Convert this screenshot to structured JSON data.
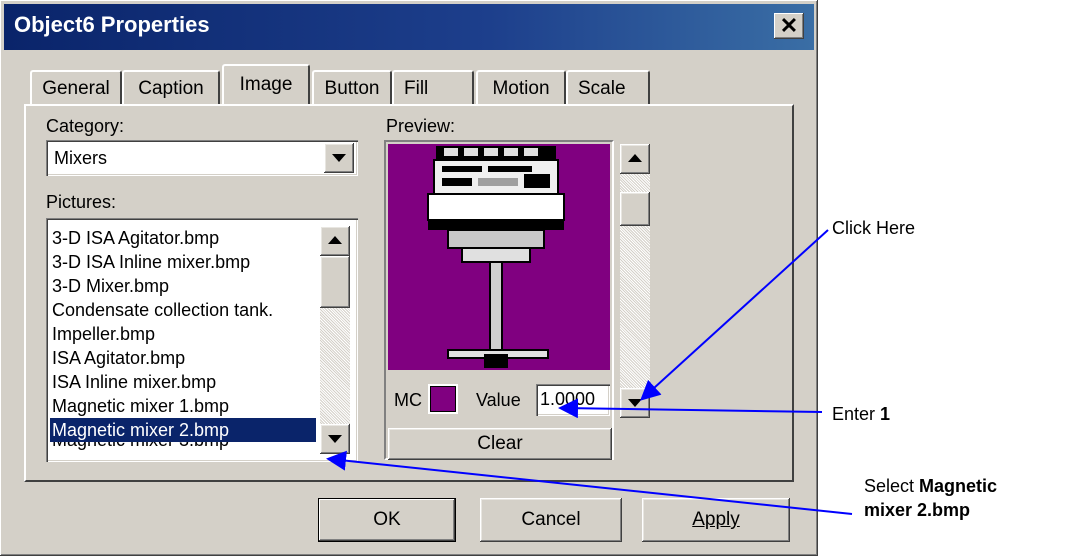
{
  "window": {
    "title": "Object6 Properties",
    "close_glyph": "✕"
  },
  "tabs": [
    {
      "label": "General",
      "active": false
    },
    {
      "label": "Caption",
      "active": false
    },
    {
      "label": "Image",
      "active": true
    },
    {
      "label": "Button",
      "active": false
    },
    {
      "label": "Fill",
      "active": false
    },
    {
      "label": "Motion",
      "active": false
    },
    {
      "label": "Scale",
      "active": false
    }
  ],
  "category": {
    "label": "Category:",
    "value": "Mixers"
  },
  "pictures": {
    "label": "Pictures:",
    "items": [
      "3-D ISA Agitator.bmp",
      "3-D ISA Inline mixer.bmp",
      "3-D Mixer.bmp",
      "Condensate collection tank.",
      "Impeller.bmp",
      "ISA Agitator.bmp",
      "ISA Inline mixer.bmp",
      "Magnetic mixer 1.bmp",
      "Magnetic mixer 2.bmp"
    ],
    "selected_index": 8
  },
  "preview": {
    "label": "Preview:",
    "background_color": "#800080",
    "mc_label": "MC",
    "mc_color": "#800080",
    "value_label": "Value",
    "value": "1.0000",
    "clear_label": "Clear"
  },
  "buttons": {
    "ok": "OK",
    "cancel": "Cancel",
    "apply": "Apply"
  },
  "annotations": {
    "click_here": "Click Here",
    "enter_prefix": "Enter ",
    "enter_bold": "1",
    "select_prefix": "Select ",
    "select_bold_1": "Magnetic",
    "select_bold_2": "mixer 2.bmp",
    "arrow_color": "#0000ff"
  }
}
